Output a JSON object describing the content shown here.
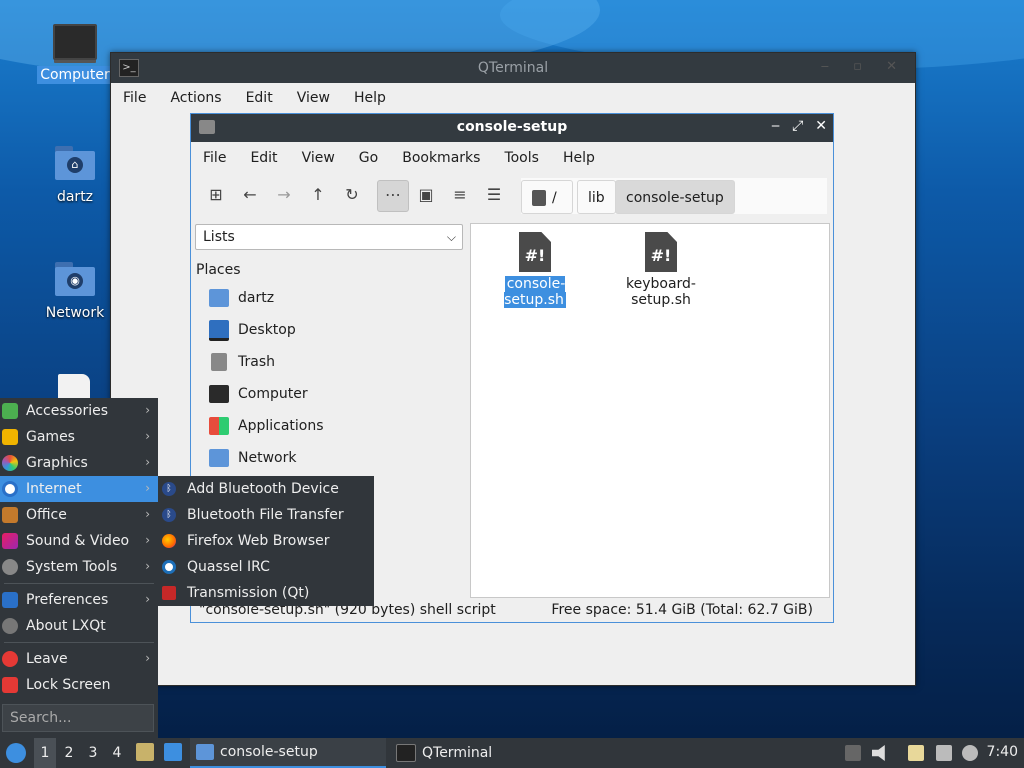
{
  "desktop": {
    "icons": [
      {
        "label": "Computer"
      },
      {
        "label": "dartz"
      },
      {
        "label": "Network"
      }
    ]
  },
  "qterminal": {
    "title": "QTerminal",
    "menu": [
      "File",
      "Actions",
      "Edit",
      "View",
      "Help"
    ]
  },
  "filemanager": {
    "title": "console-setup",
    "menu": [
      "File",
      "Edit",
      "View",
      "Go",
      "Bookmarks",
      "Tools",
      "Help"
    ],
    "breadcrumb": [
      "/",
      "lib",
      "console-setup"
    ],
    "sidebar_mode": "Lists",
    "places_heading": "Places",
    "places": [
      "dartz",
      "Desktop",
      "Trash",
      "Computer",
      "Applications",
      "Network"
    ],
    "files": [
      {
        "name": "console-setup.sh",
        "selected": true
      },
      {
        "name_line1": "keyboard-",
        "name_line2": "setup.sh",
        "selected": false
      }
    ],
    "status_left": "\"console-setup.sh\" (920 bytes) shell script",
    "status_right": "Free space: 51.4 GiB (Total: 62.7 GiB)"
  },
  "startmenu": {
    "categories": [
      "Accessories",
      "Games",
      "Graphics",
      "Internet",
      "Office",
      "Sound & Video",
      "System Tools"
    ],
    "highlighted": "Internet",
    "preferences": "Preferences",
    "about": "About LXQt",
    "leave": "Leave",
    "lock": "Lock Screen",
    "search_placeholder": "Search..."
  },
  "internet_submenu": [
    "Add Bluetooth Device",
    "Bluetooth File Transfer",
    "Firefox Web Browser",
    "Quassel IRC",
    "Transmission (Qt)"
  ],
  "taskbar": {
    "workspaces": [
      "1",
      "2",
      "3",
      "4"
    ],
    "tasks": [
      "console-setup",
      "QTerminal"
    ],
    "clock": "7:40"
  },
  "colors": {
    "accent": "#3d8fe0",
    "panel": "#31363b",
    "titlebar": "#333a40"
  }
}
